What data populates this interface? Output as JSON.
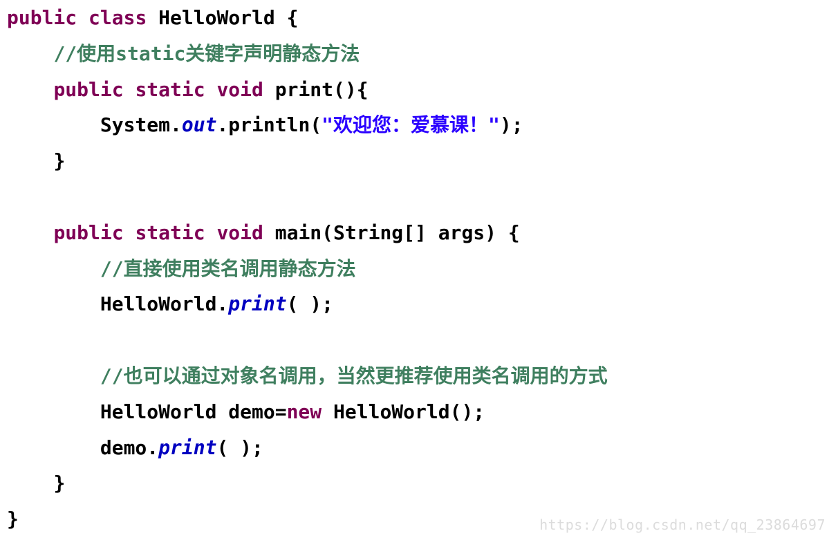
{
  "code": {
    "l1_kw1": "public",
    "l1_kw2": "class",
    "l1_cls": "HelloWorld {",
    "l2_cm": "//使用static关键字声明静态方法",
    "l3_kw": "public static void",
    "l3_m": "print(){",
    "l4_sys": "System.",
    "l4_out": "out",
    "l4_pr": ".println(",
    "l4_str": "\"欢迎您：爱慕课！\"",
    "l4_end": ");",
    "l5": "}",
    "l7_kw": "public static void",
    "l7_m": "main(String[] args) {",
    "l8_cm": "//直接使用类名调用静态方法",
    "l9_a": "HelloWorld.",
    "l9_b": "print",
    "l9_c": "( );",
    "l11_cm": "//也可以通过对象名调用，当然更推荐使用类名调用的方式",
    "l12_a": "HelloWorld demo=",
    "l12_new": "new",
    "l12_b": " HelloWorld();",
    "l13_a": "demo.",
    "l13_b": "print",
    "l13_c": "( );",
    "l14": "}",
    "l15": "}"
  },
  "watermark": "https://blog.csdn.net/qq_23864697"
}
